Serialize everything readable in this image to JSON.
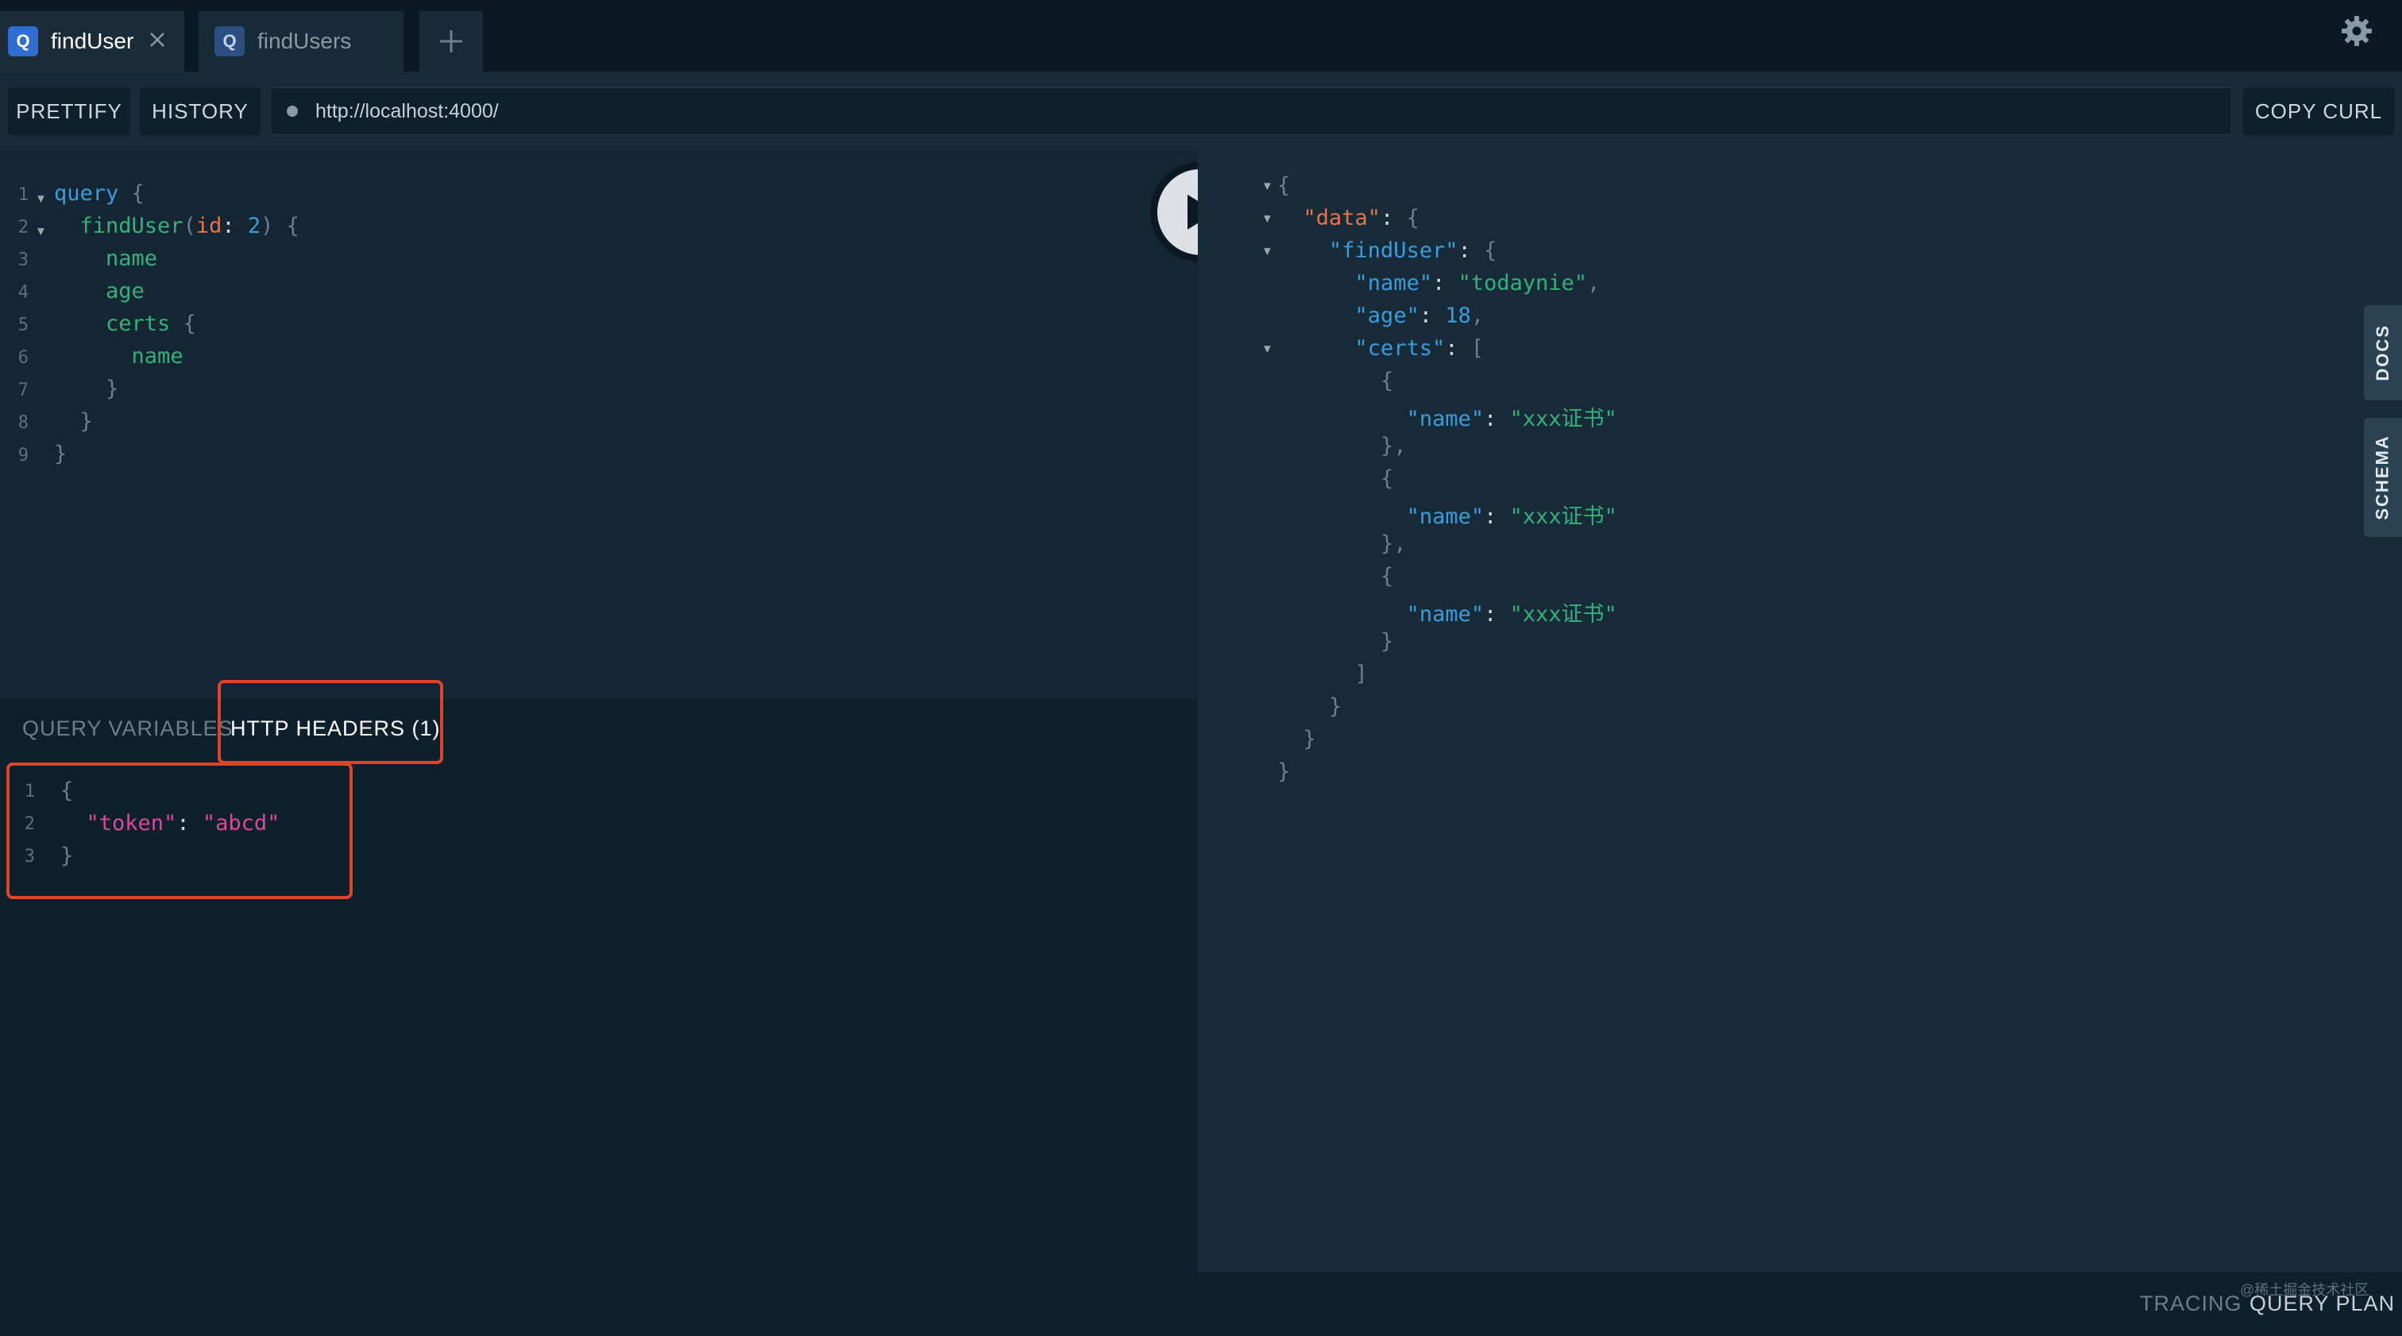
{
  "tabs": [
    {
      "badge": "Q",
      "label": "findUser",
      "active": true
    },
    {
      "badge": "Q",
      "label": "findUsers",
      "active": false
    }
  ],
  "icons": {
    "close": "close-icon",
    "add": "plus-icon",
    "settings": "gear-icon",
    "play": "play-icon"
  },
  "toolbar": {
    "prettify_label": "PRETTIFY",
    "history_label": "HISTORY",
    "url": "http://localhost:4000/",
    "copy_curl_label": "COPY CURL"
  },
  "query_editor": {
    "line_numbers": [
      "1",
      "2",
      "3",
      "4",
      "5",
      "6",
      "7",
      "8",
      "9"
    ],
    "lines": [
      "query {",
      "  findUser(id: 2) {",
      "    name",
      "    age",
      "    certs {",
      "      name",
      "    }",
      "  }",
      "}"
    ]
  },
  "variables_panel": {
    "query_variables_label": "QUERY VARIABLES",
    "http_headers_label": "HTTP HEADERS (1)",
    "line_numbers": [
      "1",
      "2",
      "3"
    ],
    "lines": [
      "{",
      "  \"token\": \"abcd\"",
      "}"
    ]
  },
  "result": {
    "lines": [
      "{",
      "  \"data\": {",
      "    \"findUser\": {",
      "      \"name\": \"todaynie\",",
      "      \"age\": 18,",
      "      \"certs\": [",
      "        {",
      "          \"name\": \"xxx证书\"",
      "        },",
      "        {",
      "          \"name\": \"xxx证书\"",
      "        },",
      "        {",
      "          \"name\": \"xxx证书\"",
      "        }",
      "      ]",
      "    }",
      "  }",
      "}"
    ]
  },
  "side_tabs": {
    "docs_label": "DOCS",
    "schema_label": "SCHEMA"
  },
  "footer": {
    "tracing_label": "TRACING",
    "query_plan_label": "QUERY PLAN",
    "watermark": "@稀土掘金技术社区"
  },
  "colors": {
    "background": "#0f202d",
    "panel": "#172a37",
    "accent_blue": "#2f6dd2",
    "highlight_red": "#e0432c",
    "string_green": "#34b07a",
    "key_blue": "#3a9cdb",
    "arg_orange": "#e8734a",
    "header_key_pink": "#d9489a"
  }
}
